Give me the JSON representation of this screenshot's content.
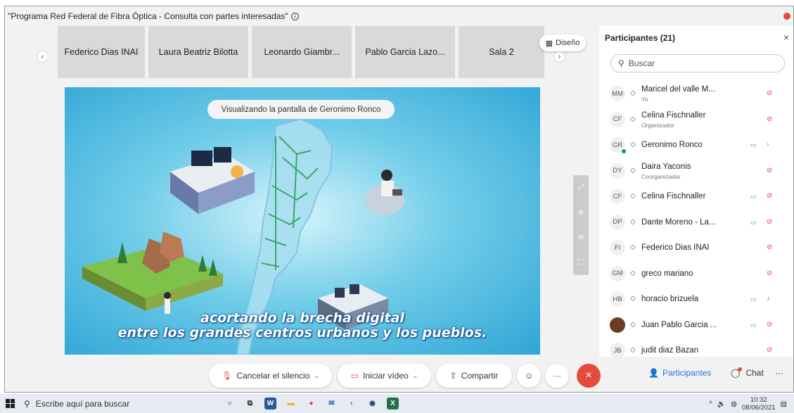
{
  "window": {
    "title": "\"Programa Red Federal de Fibra Óptica - Consulta con partes interesadas\"",
    "info_icon": "ⓘ"
  },
  "video_strip": {
    "prev_icon": "‹",
    "next_icon": "›",
    "tiles": [
      "Federico Dias INAI",
      "Laura Beatriz Bilotta",
      "Leonardo Giambr...",
      "Pablo Garcia Lazo...",
      "Sala 2"
    ],
    "layout_button": "Diseño"
  },
  "shared_screen": {
    "viewing_label": "Visualizando la pantalla de Geronimo Ronco",
    "caption_line1": "acortando la brecha digital",
    "caption_line2": "entre los grandes centros urbanos y los pueblos."
  },
  "participants_panel": {
    "title": "Participantes (21)",
    "close_icon": "×",
    "search_placeholder": "Buscar",
    "participants": [
      {
        "initials": "MM",
        "name": "Maricel del valle M...",
        "role": "Yo",
        "camera": false,
        "mic": "muted"
      },
      {
        "initials": "CF",
        "name": "Celina Fischnaller",
        "role": "Organizador",
        "camera": false,
        "mic": "muted"
      },
      {
        "initials": "GR",
        "name": "Geronimo Ronco",
        "role": "",
        "camera": true,
        "mic": "speaking"
      },
      {
        "initials": "DY",
        "name": "Daira Yaconis",
        "role": "Coorganizador",
        "camera": false,
        "mic": "muted"
      },
      {
        "initials": "CF",
        "name": "Celina Fischnaller",
        "role": "",
        "camera": true,
        "mic": "muted"
      },
      {
        "initials": "DP",
        "name": "Dante Moreno - La...",
        "role": "",
        "camera": true,
        "mic": "muted"
      },
      {
        "initials": "FI",
        "name": "Federico Dias INAI",
        "role": "",
        "camera": false,
        "mic": "muted"
      },
      {
        "initials": "GM",
        "name": "greco mariano",
        "role": "",
        "camera": false,
        "mic": "muted"
      },
      {
        "initials": "HB",
        "name": "horacio brizuela",
        "role": "",
        "camera": true,
        "mic": "on"
      },
      {
        "initials": "",
        "name": "Juan Pablo Garcia ...",
        "role": "",
        "camera": true,
        "mic": "muted"
      },
      {
        "initials": "JB",
        "name": "judit diaz Bazan",
        "role": "",
        "camera": false,
        "mic": "muted"
      }
    ]
  },
  "controls": {
    "mute_label": "Cancelar el silencio",
    "video_label": "Iniciar vídeo",
    "share_label": "Compartir",
    "reactions_icon": "☺",
    "more_icon": "···",
    "end_icon": "×",
    "participants_tab": "Participantes",
    "chat_tab": "Chat",
    "panel_more_icon": "···"
  },
  "taskbar": {
    "search_placeholder": "Escribe aquí para buscar",
    "time": "10:32",
    "date": "08/06/2021"
  },
  "colors": {
    "accent_blue": "#2b74d8",
    "muted_red": "#e24b3b",
    "end_call_red": "#e54b3c",
    "share_bg": "#71cde9"
  }
}
